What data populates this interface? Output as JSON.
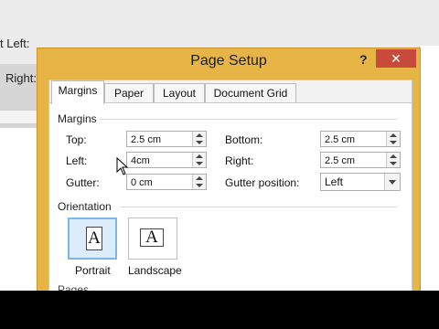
{
  "background": {
    "left_label": "t Left:",
    "right_label": "Right:"
  },
  "dialog": {
    "title": "Page Setup",
    "help_label": "?",
    "close_label": "✕",
    "tabs": [
      {
        "label": "Margins"
      },
      {
        "label": "Paper"
      },
      {
        "label": "Layout"
      },
      {
        "label": "Document Grid"
      }
    ],
    "margins": {
      "section_label": "Margins",
      "top": {
        "label": "Top:",
        "value": "2.5 cm"
      },
      "bottom": {
        "label": "Bottom:",
        "value": "2.5 cm"
      },
      "left": {
        "label": "Left:",
        "value": "4cm"
      },
      "right": {
        "label": "Right:",
        "value": "2.5 cm"
      },
      "gutter": {
        "label": "Gutter:",
        "value": "0 cm"
      },
      "gutter_position": {
        "label": "Gutter position:",
        "value": "Left"
      }
    },
    "orientation": {
      "section_label": "Orientation",
      "portrait": {
        "label": "Portrait",
        "glyph": "A"
      },
      "landscape": {
        "label": "Landscape",
        "glyph": "A"
      }
    },
    "paper_partial_label": "Pages"
  },
  "colors": {
    "dialog_frame": "#e6b545",
    "close_button": "#c74a3a",
    "selected_orientation": "#dcecfb"
  }
}
